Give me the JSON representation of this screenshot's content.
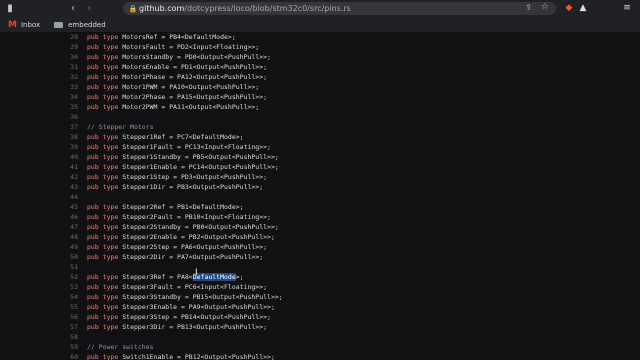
{
  "browser": {
    "url_host": "github.com",
    "url_path": "/dotcypress/loco/blob/stm32c0/src/pins.rs",
    "bookmarks": [
      {
        "label": "Inbox",
        "icon": "gmail-icon"
      },
      {
        "label": "embedded",
        "icon": "folder-icon"
      }
    ]
  },
  "code": {
    "lines": [
      {
        "n": "28",
        "code": "pub type MotorsRef = PB4<DefaultMode>;"
      },
      {
        "n": "29",
        "code": "pub type MotorsFault = PD2<Input<Floating>>;"
      },
      {
        "n": "30",
        "code": "pub type MotorsStandby = PD0<Output<PushPull>>;"
      },
      {
        "n": "31",
        "code": "pub type MotorsEnable = PD1<Output<PushPull>>;"
      },
      {
        "n": "32",
        "code": "pub type Motor1Phase = PA12<Output<PushPull>>;"
      },
      {
        "n": "33",
        "code": "pub type Motor1PWM = PA10<Output<PushPull>>;"
      },
      {
        "n": "34",
        "code": "pub type Motor2Phase = PA15<Output<PushPull>>;"
      },
      {
        "n": "35",
        "code": "pub type Motor2PWM = PA11<Output<PushPull>>;"
      },
      {
        "n": "36",
        "code": ""
      },
      {
        "n": "37",
        "code": "// Stepper Motors"
      },
      {
        "n": "38",
        "code": "pub type Stepper1Ref = PC7<DefaultMode>;"
      },
      {
        "n": "39",
        "code": "pub type Stepper1Fault = PC13<Input<Floating>>;"
      },
      {
        "n": "40",
        "code": "pub type Stepper1Standby = PB5<Output<PushPull>>;"
      },
      {
        "n": "41",
        "code": "pub type Stepper1Enable = PC14<Output<PushPull>>;"
      },
      {
        "n": "42",
        "code": "pub type Stepper1Step = PD3<Output<PushPull>>;"
      },
      {
        "n": "43",
        "code": "pub type Stepper1Dir = PB3<Output<PushPull>>;"
      },
      {
        "n": "44",
        "code": ""
      },
      {
        "n": "45",
        "code": "pub type Stepper2Ref = PB1<DefaultMode>;"
      },
      {
        "n": "46",
        "code": "pub type Stepper2Fault = PB10<Input<Floating>>;"
      },
      {
        "n": "47",
        "code": "pub type Stepper2Standby = PB0<Output<PushPull>>;"
      },
      {
        "n": "48",
        "code": "pub type Stepper2Enable = PB2<Output<PushPull>>;"
      },
      {
        "n": "49",
        "code": "pub type Stepper2Step = PA6<Output<PushPull>>;"
      },
      {
        "n": "50",
        "code": "pub type Stepper2Dir = PA7<Output<PushPull>>;"
      },
      {
        "n": "51",
        "code": ""
      },
      {
        "n": "52",
        "code": "pub type Stepper3Ref = PA8<DefaultMode>;",
        "selected": "DefaultMode"
      },
      {
        "n": "53",
        "code": "pub type Stepper3Fault = PC6<Input<Floating>>;"
      },
      {
        "n": "54",
        "code": "pub type Stepper3Standby = PB15<Output<PushPull>>;"
      },
      {
        "n": "55",
        "code": "pub type Stepper3Enable = PA9<Output<PushPull>>;"
      },
      {
        "n": "56",
        "code": "pub type Stepper3Step = PB14<Output<PushPull>>;"
      },
      {
        "n": "57",
        "code": "pub type Stepper3Dir = PB13<Output<PushPull>>;"
      },
      {
        "n": "58",
        "code": ""
      },
      {
        "n": "59",
        "code": "// Power switches"
      },
      {
        "n": "60",
        "code": "pub type Switch1Enable = PB12<Output<PushPull>>;"
      }
    ]
  },
  "colors": {
    "keyword": "#ff7b72",
    "comment": "#8b949e",
    "selection": "#1f4b82",
    "background": "#111113"
  }
}
